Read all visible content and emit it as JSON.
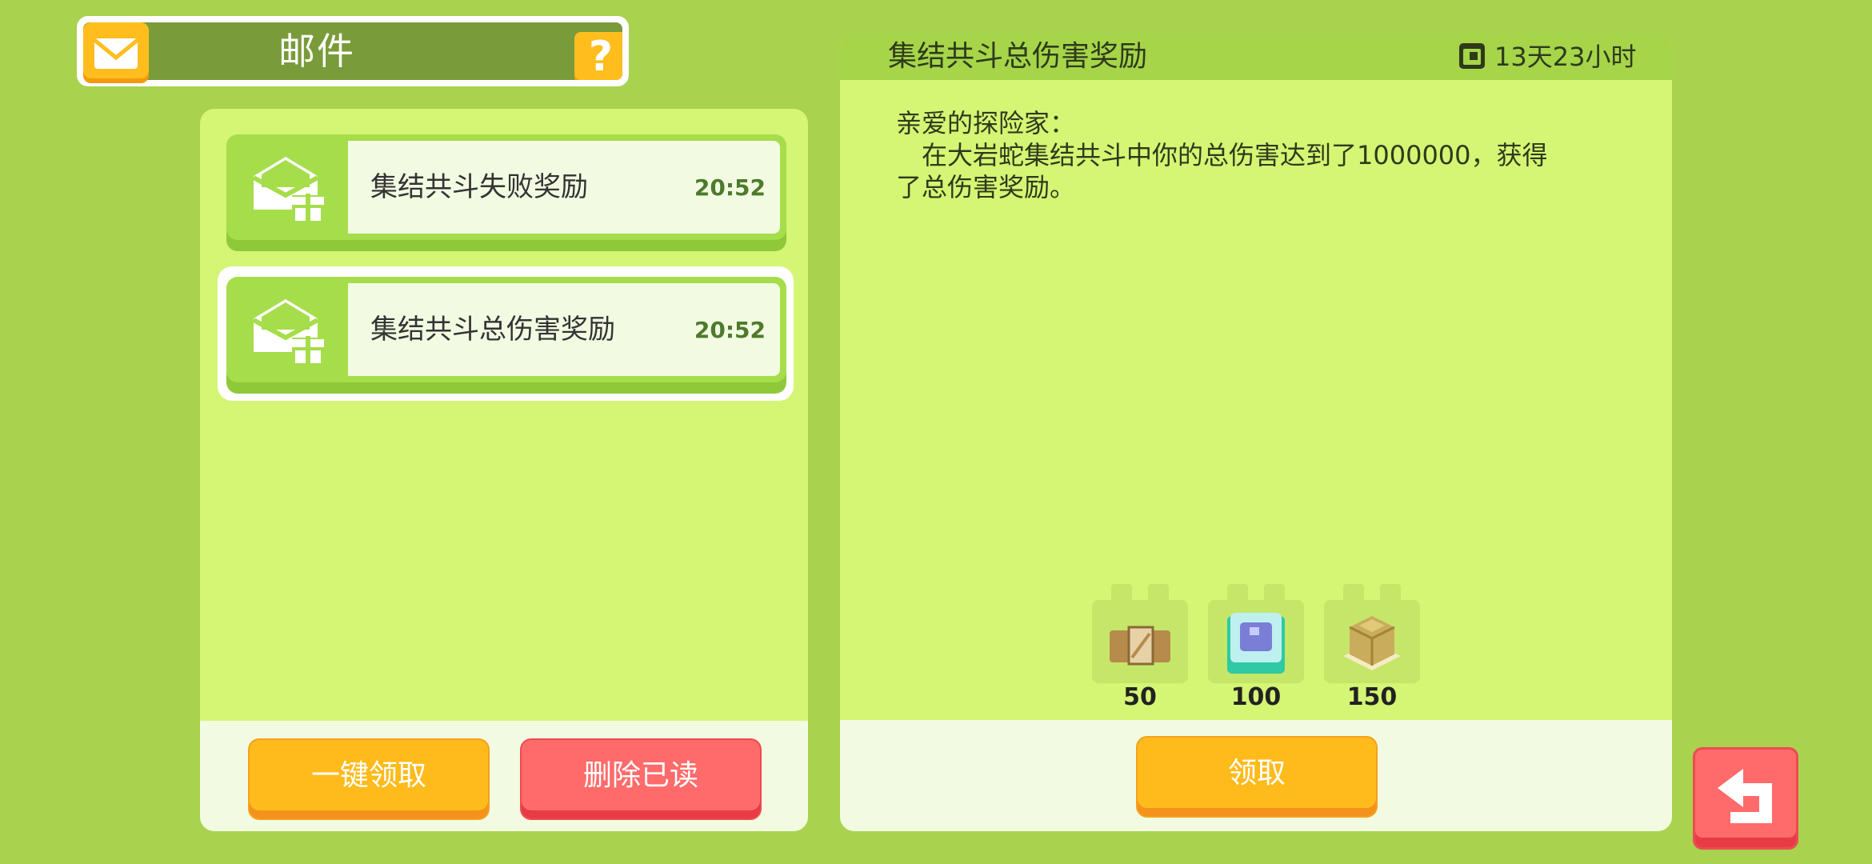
{
  "header": {
    "title": "邮件",
    "help_label": "?",
    "mail_icon": "mail-icon",
    "accent": "#ffbe1e"
  },
  "mail_list": [
    {
      "subject": "集结共斗失败奖励",
      "time": "20:52",
      "icon": "envelope-gift-icon",
      "selected": false
    },
    {
      "subject": "集结共斗总伤害奖励",
      "time": "20:52",
      "icon": "envelope-gift-icon",
      "selected": true
    }
  ],
  "list_actions": {
    "claim_all": "一键领取",
    "delete_read": "删除已读"
  },
  "detail": {
    "title": "集结共斗总伤害奖励",
    "expire": "13天23小时",
    "expire_icon": "calendar-icon",
    "message": "亲爱的探险家：\n　在大岩蛇集结共斗中你的总伤害达到了1000000，获得\n了总伤害奖励。",
    "rewards": [
      {
        "icon": "ticket-icon",
        "count": "50"
      },
      {
        "icon": "blue-cube-icon",
        "count": "100"
      },
      {
        "icon": "gold-ingot-icon",
        "count": "150"
      }
    ],
    "claim_label": "领取"
  },
  "back_icon": "back-arrow-icon",
  "colors": {
    "background": "#a9d24e",
    "panel": "#d5f574",
    "yellow_button": "#ffbb1c",
    "red_button": "#ff6b6b"
  }
}
